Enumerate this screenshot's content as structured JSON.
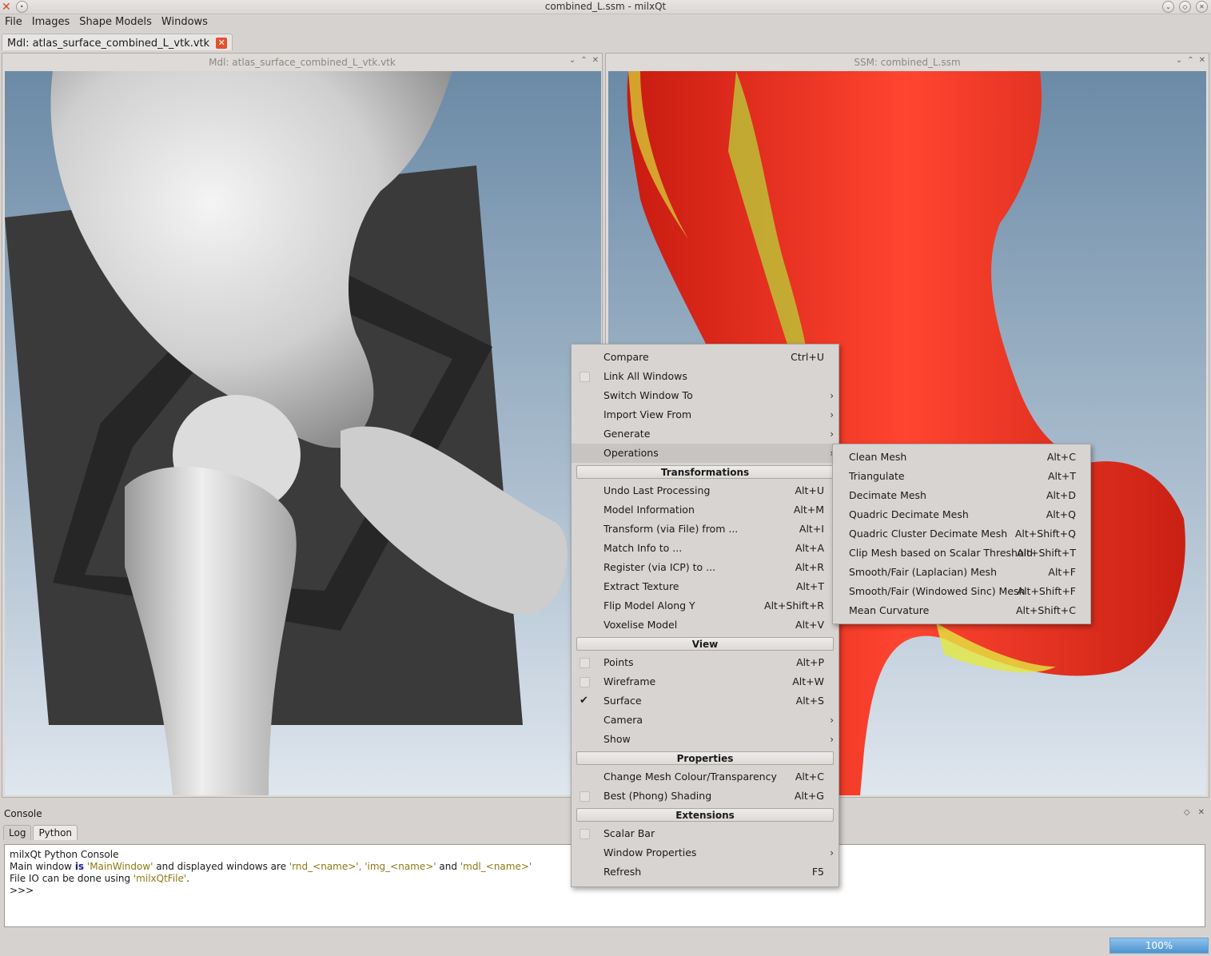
{
  "window": {
    "title": "combined_L.ssm - milxQt"
  },
  "menubar": [
    "File",
    "Images",
    "Shape Models",
    "Windows"
  ],
  "doc_tab": {
    "label": "Mdl: atlas_surface_combined_L_vtk.vtk"
  },
  "left_window": {
    "title": "Mdl: atlas_surface_combined_L_vtk.vtk"
  },
  "right_window": {
    "title": "SSM: combined_L.ssm"
  },
  "context_menu": {
    "items_top": [
      {
        "label": "Compare",
        "shortcut": "Ctrl+U"
      },
      {
        "label": "Link All Windows",
        "shortcut": ""
      },
      {
        "label": "Switch Window To",
        "shortcut": ""
      },
      {
        "label": "Import View From",
        "shortcut": ""
      },
      {
        "label": "Generate",
        "shortcut": ""
      },
      {
        "label": "Operations",
        "shortcut": ""
      }
    ],
    "transformations": {
      "header": "Transformations",
      "items": [
        {
          "label": "Undo Last Processing",
          "shortcut": "Alt+U"
        },
        {
          "label": "Model Information",
          "shortcut": "Alt+M"
        },
        {
          "label": "Transform (via File) from ...",
          "shortcut": "Alt+I"
        },
        {
          "label": "Match Info to ...",
          "shortcut": "Alt+A"
        },
        {
          "label": "Register (via ICP) to ...",
          "shortcut": "Alt+R"
        },
        {
          "label": "Extract Texture",
          "shortcut": "Alt+T"
        },
        {
          "label": "Flip Model Along Y",
          "shortcut": "Alt+Shift+R"
        },
        {
          "label": "Voxelise Model",
          "shortcut": "Alt+V"
        }
      ]
    },
    "view": {
      "header": "View",
      "items": [
        {
          "label": "Points",
          "shortcut": "Alt+P"
        },
        {
          "label": "Wireframe",
          "shortcut": "Alt+W"
        },
        {
          "label": "Surface",
          "shortcut": "Alt+S"
        },
        {
          "label": "Camera",
          "shortcut": ""
        },
        {
          "label": "Show",
          "shortcut": ""
        }
      ]
    },
    "properties": {
      "header": "Properties",
      "items": [
        {
          "label": "Change Mesh Colour/Transparency",
          "shortcut": "Alt+C"
        },
        {
          "label": "Best (Phong) Shading",
          "shortcut": "Alt+G"
        }
      ]
    },
    "extensions": {
      "header": "Extensions",
      "items": [
        {
          "label": "Scalar Bar",
          "shortcut": ""
        },
        {
          "label": "Window Properties",
          "shortcut": ""
        },
        {
          "label": "Refresh",
          "shortcut": "F5"
        }
      ]
    }
  },
  "operations_menu": [
    {
      "label": "Clean Mesh",
      "shortcut": "Alt+C"
    },
    {
      "label": "Triangulate",
      "shortcut": "Alt+T"
    },
    {
      "label": "Decimate Mesh",
      "shortcut": "Alt+D"
    },
    {
      "label": "Quadric Decimate Mesh",
      "shortcut": "Alt+Q"
    },
    {
      "label": "Quadric Cluster Decimate Mesh",
      "shortcut": "Alt+Shift+Q"
    },
    {
      "label": "Clip Mesh based on Scalar Threshold",
      "shortcut": "Alt+Shift+T"
    },
    {
      "label": "Smooth/Fair (Laplacian) Mesh",
      "shortcut": "Alt+F"
    },
    {
      "label": "Smooth/Fair (Windowed Sinc) Mesh",
      "shortcut": "Alt+Shift+F"
    },
    {
      "label": "Mean Curvature",
      "shortcut": "Alt+Shift+C"
    }
  ],
  "console": {
    "title": "Console",
    "tabs": [
      "Log",
      "Python"
    ],
    "line1": "milxQt Python Console",
    "line2_a": "Main window ",
    "line2_kw": "is",
    "line2_s1": " 'MainWindow'",
    "line2_b": " and displayed windows are ",
    "line2_s2": "'rnd_<name>', 'img_<name>'",
    "line2_c": " and ",
    "line2_s3": "'mdl_<name>'",
    "line3_a": "File IO can be done using ",
    "line3_s": "'milxQtFile'",
    "line3_b": ".",
    "prompt": ">>>"
  },
  "status": {
    "progress": "100%"
  }
}
